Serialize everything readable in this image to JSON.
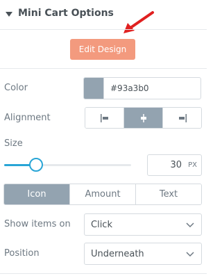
{
  "header": {
    "title": "Mini Cart Options"
  },
  "edit_design": {
    "label": "Edit Design",
    "color": "#f39a7e"
  },
  "color": {
    "label": "Color",
    "value": "#93a3b0",
    "swatch": "#93a3b0"
  },
  "alignment": {
    "label": "Alignment",
    "options": [
      "align-left-icon",
      "align-center-icon",
      "align-right-icon"
    ],
    "selected": "align-center-icon"
  },
  "size": {
    "label": "Size",
    "value": "30",
    "unit": "PX",
    "slider_fraction": 0.25
  },
  "display_tabs": {
    "items": [
      "Icon",
      "Amount",
      "Text"
    ],
    "active": "Icon"
  },
  "show_items_on": {
    "label": "Show items on",
    "value": "Click"
  },
  "position": {
    "label": "Position",
    "value": "Underneath"
  },
  "colors": {
    "accent": "#29a5d6",
    "active": "#93a3b0",
    "annotation": "#e02020"
  }
}
